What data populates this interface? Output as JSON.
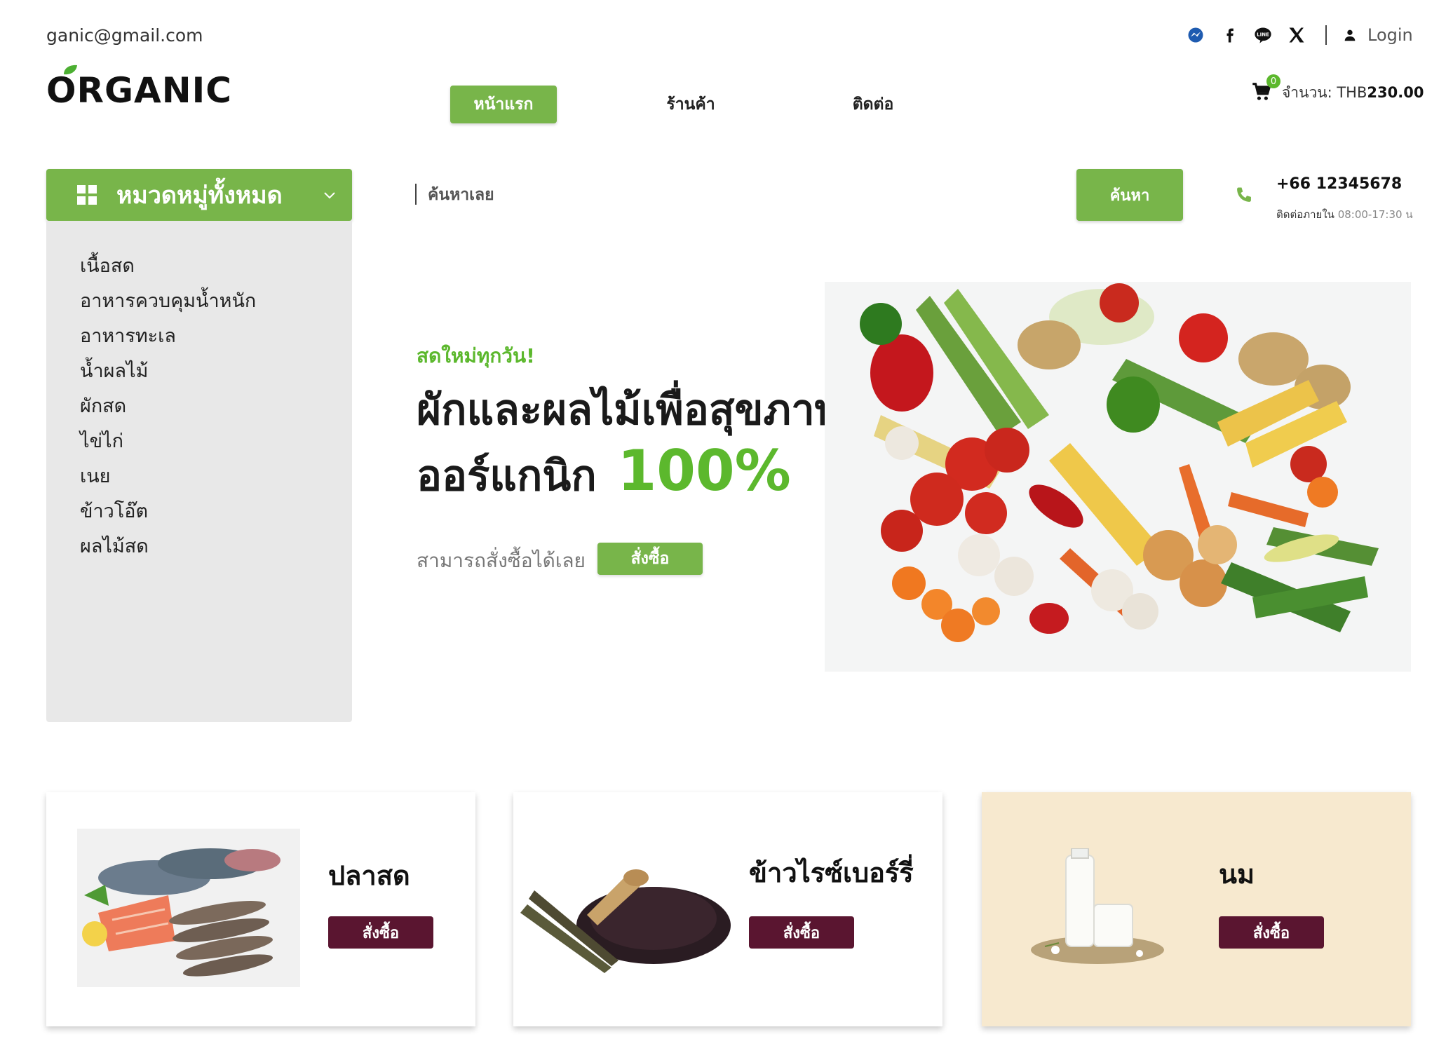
{
  "topbar": {
    "email": "ganic@gmail.com",
    "social_icons": [
      "messenger-icon",
      "facebook-icon",
      "line-icon",
      "x-icon"
    ],
    "login_label": "Login"
  },
  "header": {
    "logo": "ORGANIC",
    "nav": [
      {
        "label": "หน้าแรก",
        "active": true
      },
      {
        "label": "ร้านค้า",
        "active": false
      },
      {
        "label": "ติดต่อ",
        "active": false
      }
    ],
    "cart": {
      "count": "0",
      "label": "จำนวน: THB",
      "amount": "230.00"
    }
  },
  "categories": {
    "title": "หมวดหมู่ทั้งหมด",
    "items": [
      "เนื้อสด",
      "อาหารควบคุมน้ำหนัก",
      "อาหารทะเล",
      "น้ำผลไม้",
      "ผักสด",
      "ไข่ไก่",
      "เนย",
      "ข้าวโอ๊ต",
      "ผลไม้สด"
    ]
  },
  "search": {
    "placeholder": "ค้นหาเลย",
    "button_label": "ค้นหา"
  },
  "contact": {
    "phone": "+66 12345678",
    "hours_label": "ติดต่อภายใน",
    "hours_time": "08:00-17:30 น"
  },
  "hero": {
    "tagline": "สดใหม่ทุกวัน!",
    "headline_1": "ผักและผลไม้เพื่อสุขภาพ",
    "headline_2": "ออร์แกนิก",
    "headline_pct": "100%",
    "subtext": "สามารถสั่งซื้อได้เลย",
    "button_label": "สั่งซื้อ"
  },
  "cards": [
    {
      "title": "ปลาสด",
      "button_label": "สั่งซื้อ"
    },
    {
      "title": "ข้าวไรซ์เบอร์รี่",
      "button_label": "สั่งซื้อ"
    },
    {
      "title": "นม",
      "button_label": "สั่งซื้อ"
    }
  ],
  "colors": {
    "accent_green": "#78b54a",
    "text_green": "#5cb82d",
    "button_maroon": "#5a1530",
    "card_cream": "#f7e9cf",
    "panel_gray": "#e8e8e8"
  }
}
